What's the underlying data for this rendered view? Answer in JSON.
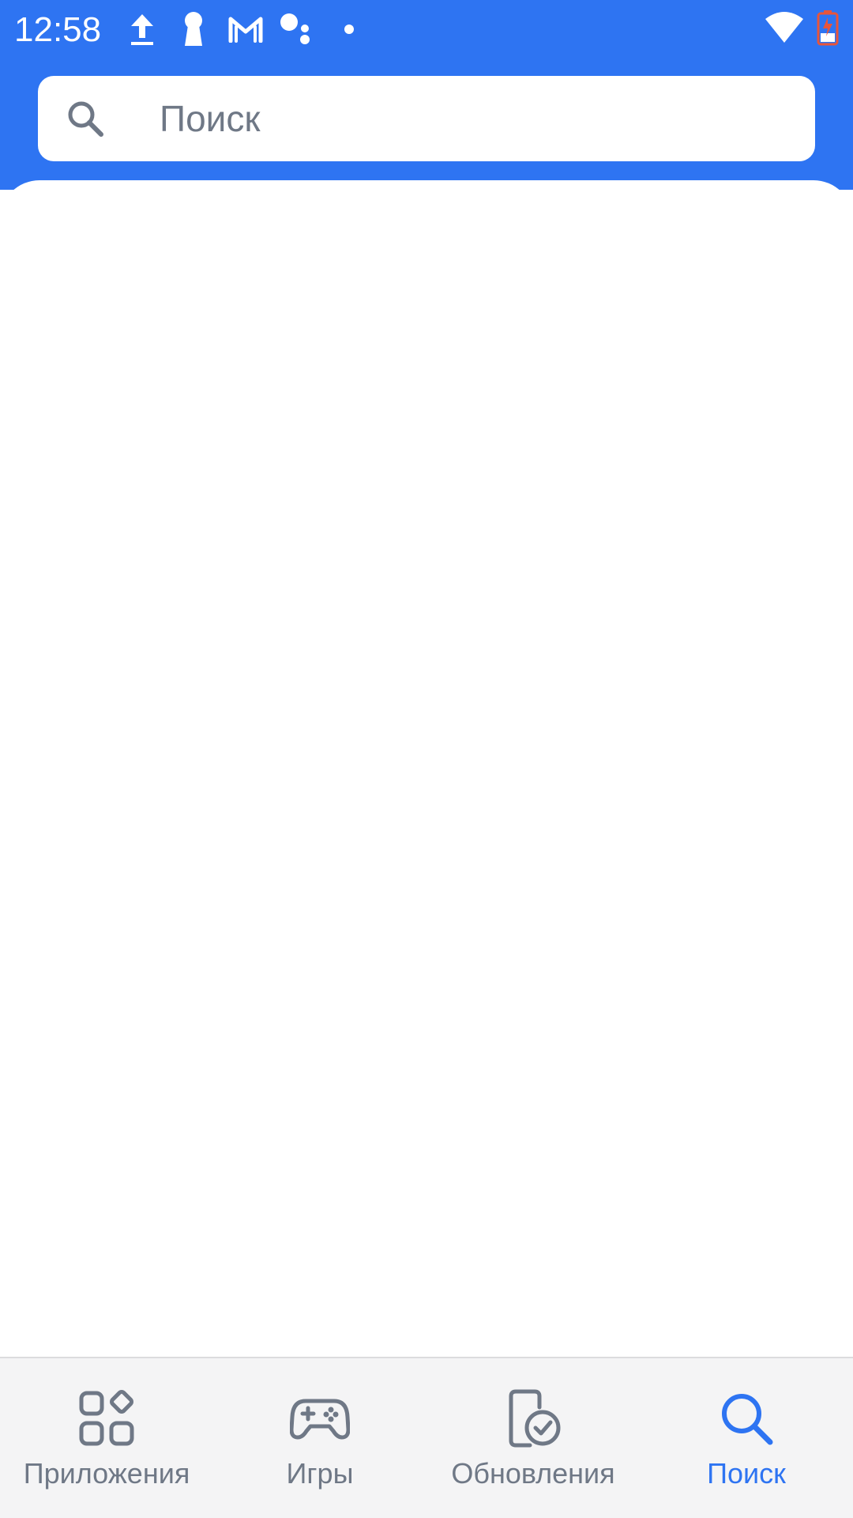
{
  "status_bar": {
    "time": "12:58",
    "icons": [
      "upload-icon",
      "keyhole-icon",
      "gmail-icon",
      "assistant-icon",
      "dot-icon",
      "wifi-icon",
      "battery-charging-icon"
    ]
  },
  "search": {
    "placeholder": "Поиск",
    "value": ""
  },
  "bottom_nav": {
    "items": [
      {
        "label": "Приложения",
        "icon": "apps-grid-icon",
        "active": false
      },
      {
        "label": "Игры",
        "icon": "gamepad-icon",
        "active": false
      },
      {
        "label": "Обновления",
        "icon": "updates-icon",
        "active": false
      },
      {
        "label": "Поиск",
        "icon": "search-icon",
        "active": true
      }
    ]
  },
  "colors": {
    "brand": "#2e74f2",
    "inactive": "#6f7886",
    "nav_background": "#f4f4f5",
    "battery_warning": "#e8553a"
  }
}
